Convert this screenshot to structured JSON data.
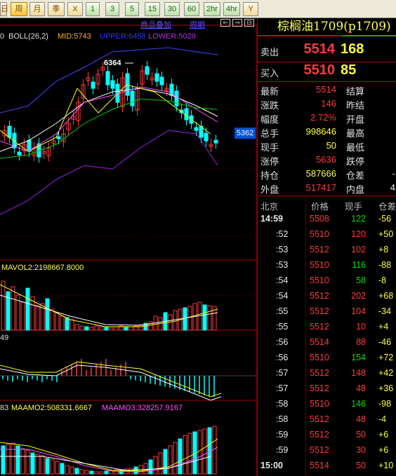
{
  "toolbar": {
    "buttons": [
      "日",
      "周",
      "月",
      "季",
      "X",
      "1",
      "3",
      "5",
      "15",
      "30",
      "60",
      "2hr",
      "4hr",
      "Y"
    ],
    "active": "周"
  },
  "chart": {
    "tabs": {
      "overlay": "商品叠加",
      "period": "周期"
    },
    "main": {
      "boll": "BOLL(26,2)",
      "mid": "MID:5743",
      "upper": "UPPER:6458",
      "lower": "LOWER:5028",
      "high_label": "6364",
      "price_tag": "5362",
      "leading_digit": "0"
    },
    "vol": {
      "label": "MAVOL2:2198667.8000"
    },
    "macd": {
      "label": "49"
    },
    "oi": {
      "label1": "83",
      "label2": "MAAMO2:508331.6667",
      "label3": "MAAMO3:328257.9167"
    },
    "colors": {
      "up": "#ff3b3b",
      "down": "#00ffff",
      "mid": "#ffffff",
      "upper": "#4444ff",
      "lower": "#a020f0",
      "ma_yellow": "#ffff00",
      "ma_pink": "#ff55ff",
      "ma_green": "#00cc00"
    }
  },
  "quote": {
    "title": "棕榈油1709(p1709)",
    "sell_label": "卖出",
    "sell_price": "5514",
    "sell_vol": "168",
    "buy_label": "买入",
    "buy_price": "5510",
    "buy_vol": "85",
    "rows": [
      {
        "l1": "最新",
        "v1": "5514",
        "c1": "red",
        "l2": "结算",
        "v2": ""
      },
      {
        "l1": "涨跌",
        "v1": "146",
        "c1": "red",
        "l2": "昨结",
        "v2": ""
      },
      {
        "l1": "幅度",
        "v1": "2.72%",
        "c1": "red",
        "l2": "开盘",
        "v2": ""
      },
      {
        "l1": "总手",
        "v1": "998646",
        "c1": "yellow",
        "l2": "最高",
        "v2": ""
      },
      {
        "l1": "现手",
        "v1": "50",
        "c1": "yellow",
        "l2": "最低",
        "v2": ""
      },
      {
        "l1": "涨停",
        "v1": "5636",
        "c1": "red",
        "l2": "跌停",
        "v2": ""
      },
      {
        "l1": "持仓",
        "v1": "587666",
        "c1": "yellow",
        "l2": "仓差",
        "v2": "-"
      },
      {
        "l1": "外盘",
        "v1": "517417",
        "c1": "red",
        "l2": "内盘",
        "v2": "4"
      }
    ],
    "tick_header": {
      "time": "北京",
      "price": "价格",
      "vol": "现手",
      "oi": "仓差"
    },
    "ticks": [
      {
        "t": "14:59",
        "p": "5508",
        "v": "122",
        "vc": "green",
        "o": "-56",
        "oc": "yellow"
      },
      {
        "t": ":52",
        "p": "5510",
        "v": "120",
        "vc": "red",
        "o": "+50",
        "oc": "yellow"
      },
      {
        "t": ":53",
        "p": "5512",
        "v": "102",
        "vc": "red",
        "o": "+8",
        "oc": "yellow"
      },
      {
        "t": ":53",
        "p": "5510",
        "v": "116",
        "vc": "green",
        "o": "-88",
        "oc": "yellow"
      },
      {
        "t": ":54",
        "p": "5510",
        "v": "58",
        "vc": "green",
        "o": "-8",
        "oc": "yellow"
      },
      {
        "t": ":54",
        "p": "5512",
        "v": "202",
        "vc": "red",
        "o": "+68",
        "oc": "yellow"
      },
      {
        "t": ":55",
        "p": "5512",
        "v": "104",
        "vc": "red",
        "o": "-34",
        "oc": "yellow"
      },
      {
        "t": ":55",
        "p": "5512",
        "v": "10",
        "vc": "red",
        "o": "+4",
        "oc": "yellow"
      },
      {
        "t": ":56",
        "p": "5514",
        "v": "88",
        "vc": "red",
        "o": "-46",
        "oc": "yellow"
      },
      {
        "t": ":56",
        "p": "5510",
        "v": "154",
        "vc": "green",
        "o": "+72",
        "oc": "yellow"
      },
      {
        "t": ":57",
        "p": "5512",
        "v": "148",
        "vc": "red",
        "o": "+42",
        "oc": "yellow"
      },
      {
        "t": ":57",
        "p": "5512",
        "v": "48",
        "vc": "red",
        "o": "+36",
        "oc": "yellow"
      },
      {
        "t": ":58",
        "p": "5510",
        "v": "146",
        "vc": "green",
        "o": "-98",
        "oc": "yellow"
      },
      {
        "t": ":58",
        "p": "5512",
        "v": "48",
        "vc": "red",
        "o": "-4",
        "oc": "yellow"
      },
      {
        "t": ":59",
        "p": "5512",
        "v": "50",
        "vc": "red",
        "o": "+6",
        "oc": "yellow"
      },
      {
        "t": ":59",
        "p": "5512",
        "v": "30",
        "vc": "red",
        "o": "+6",
        "oc": "yellow"
      },
      {
        "t": "15:00",
        "p": "5514",
        "v": "50",
        "vc": "red",
        "o": "+10",
        "oc": "yellow"
      }
    ]
  }
}
